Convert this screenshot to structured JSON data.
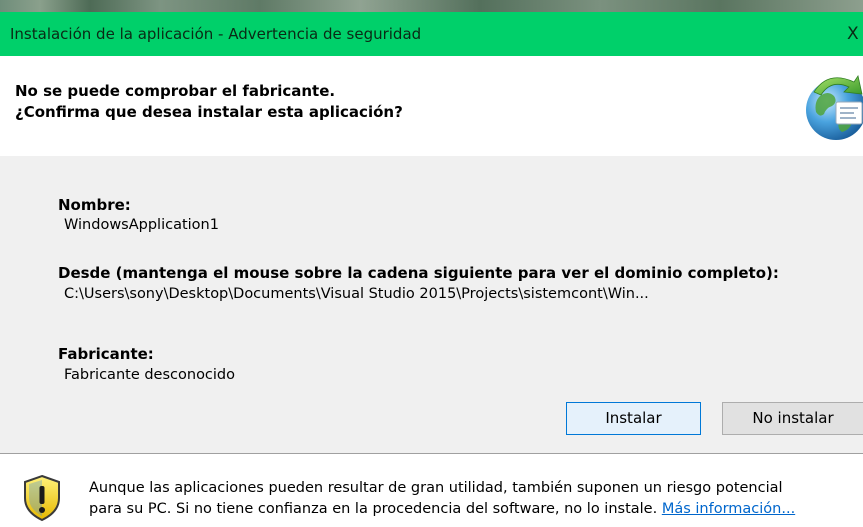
{
  "window": {
    "title": "Instalación de la aplicación - Advertencia de seguridad",
    "close_glyph": "X"
  },
  "header": {
    "line1": "No se puede comprobar el fabricante.",
    "line2": "¿Confirma que desea instalar esta aplicación?",
    "icon": "globe-icon"
  },
  "details": {
    "name_label": "Nombre:",
    "name_value": "WindowsApplication1",
    "from_label": "Desde (mantenga el mouse sobre la cadena siguiente para ver el dominio completo):",
    "from_value": "C:\\Users\\sony\\Desktop\\Documents\\Visual Studio 2015\\Projects\\sistemcont\\Win...",
    "publisher_label": "Fabricante:",
    "publisher_value": "Fabricante desconocido"
  },
  "buttons": {
    "install": "Instalar",
    "no_install": "No instalar"
  },
  "footer": {
    "icon": "warning-shield-icon",
    "line1": "Aunque las aplicaciones pueden resultar de gran utilidad, también suponen un riesgo potencial",
    "line2_text": "para su PC. Si no tiene confianza en la procedencia del software, no lo instale.",
    "more_info_link": "Más información..."
  },
  "colors": {
    "titlebar": "#00d06a",
    "content_bg": "#f0f0f0",
    "header_bg": "#ffffff",
    "link": "#0066cc",
    "default_button_border": "#0078d7"
  }
}
